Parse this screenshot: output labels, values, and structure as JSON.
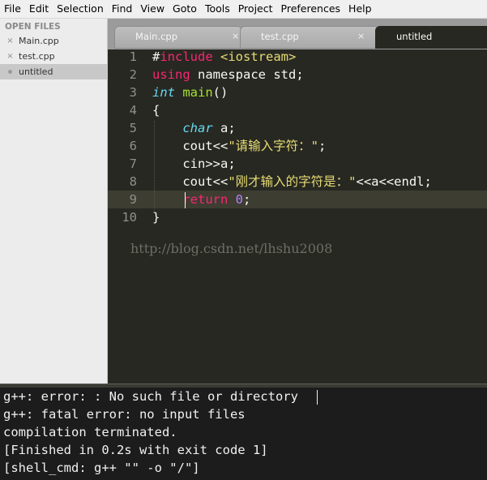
{
  "menubar": {
    "items": [
      "File",
      "Edit",
      "Selection",
      "Find",
      "View",
      "Goto",
      "Tools",
      "Project",
      "Preferences",
      "Help"
    ]
  },
  "sidebar": {
    "header": "OPEN FILES",
    "files": [
      {
        "name": "Main.cpp",
        "marker": "×"
      },
      {
        "name": "test.cpp",
        "marker": "×"
      },
      {
        "name": "untitled",
        "marker": "dot"
      }
    ]
  },
  "tabs": [
    {
      "label": "Main.cpp",
      "close": "×"
    },
    {
      "label": "test.cpp",
      "close": "×"
    },
    {
      "label": "untitled",
      "close": ""
    }
  ],
  "editor": {
    "line_numbers": [
      "1",
      "2",
      "3",
      "4",
      "5",
      "6",
      "7",
      "8",
      "9",
      "10"
    ],
    "current_line": "9",
    "lines": [
      [
        {
          "t": "#",
          "c": ""
        },
        {
          "t": "include",
          "c": "kw"
        },
        {
          "t": " ",
          "c": ""
        },
        {
          "t": "<iostream>",
          "c": "str"
        }
      ],
      [
        {
          "t": "using",
          "c": "kw"
        },
        {
          "t": " namespace std;",
          "c": ""
        }
      ],
      [
        {
          "t": "int",
          "c": "type"
        },
        {
          "t": " ",
          "c": ""
        },
        {
          "t": "main",
          "c": "fn"
        },
        {
          "t": "()",
          "c": ""
        }
      ],
      [
        {
          "t": "{",
          "c": ""
        }
      ],
      [
        {
          "t": "    ",
          "c": ""
        },
        {
          "t": "char",
          "c": "type"
        },
        {
          "t": " a;",
          "c": ""
        }
      ],
      [
        {
          "t": "    cout<<",
          "c": ""
        },
        {
          "t": "\"请输入字符：\"",
          "c": "str"
        },
        {
          "t": ";",
          "c": ""
        }
      ],
      [
        {
          "t": "    cin>>a;",
          "c": ""
        }
      ],
      [
        {
          "t": "    cout<<",
          "c": ""
        },
        {
          "t": "\"刚才输入的字符是：\"",
          "c": "str"
        },
        {
          "t": "<<a<<endl;",
          "c": ""
        }
      ],
      [
        {
          "t": "    ",
          "c": ""
        },
        {
          "t": "return",
          "c": "kw"
        },
        {
          "t": " ",
          "c": ""
        },
        {
          "t": "0",
          "c": "num"
        },
        {
          "t": ";",
          "c": ""
        }
      ],
      [
        {
          "t": "}",
          "c": ""
        }
      ]
    ],
    "watermark": "http://blog.csdn.net/lhshu2008"
  },
  "output": {
    "lines": [
      "g++: error: : No such file or directory",
      "g++: fatal error: no input files",
      "compilation terminated.",
      "[Finished in 0.2s with exit code 1]",
      "[shell_cmd: g++ \"\" -o \"/\"]"
    ]
  },
  "colors": {
    "editor_bg": "#272822",
    "keyword": "#f92672",
    "type": "#66d9ef",
    "function": "#a6e22e",
    "string": "#e6db74",
    "number": "#ae81ff",
    "output_bg": "#1c1c1c"
  }
}
